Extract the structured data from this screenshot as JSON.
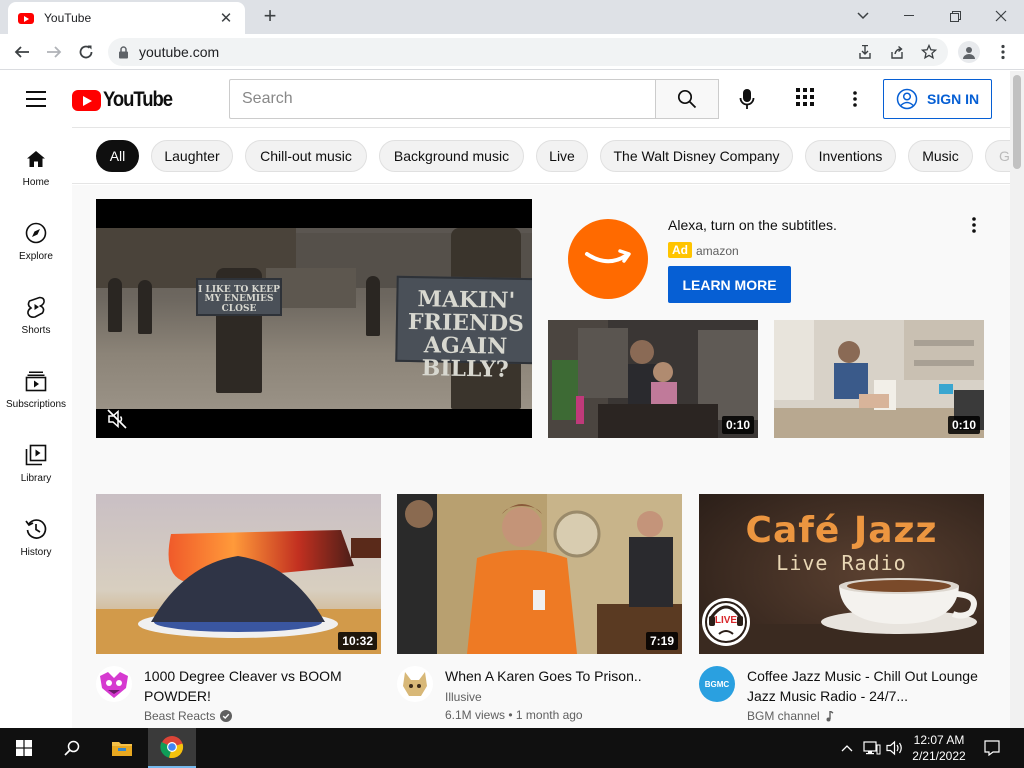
{
  "browser": {
    "tab_title": "YouTube",
    "url": "youtube.com"
  },
  "masthead": {
    "logo_text": "YouTube",
    "search_placeholder": "Search",
    "sign_in_label": "SIGN IN"
  },
  "guide": {
    "items": [
      {
        "label": "Home",
        "icon": "home-icon"
      },
      {
        "label": "Explore",
        "icon": "compass-icon"
      },
      {
        "label": "Shorts",
        "icon": "shorts-icon"
      },
      {
        "label": "Subscriptions",
        "icon": "subscriptions-icon"
      },
      {
        "label": "Library",
        "icon": "library-icon"
      },
      {
        "label": "History",
        "icon": "history-icon"
      }
    ]
  },
  "chips": [
    "All",
    "Laughter",
    "Chill-out music",
    "Background music",
    "Live",
    "The Walt Disney Company",
    "Inventions",
    "Music",
    "G"
  ],
  "ad": {
    "scene_sign_left": "I LIKE TO KEEP MY ENEMIES CLOSE",
    "scene_sign_right": "MAKIN' FRIENDS AGAIN BILLY?",
    "title": "Alexa, turn on the subtitles.",
    "badge": "Ad",
    "source": "amazon",
    "cta": "LEARN MORE",
    "thumb1_duration": "0:10",
    "thumb2_duration": "0:10"
  },
  "videos": [
    {
      "title": "1000 Degree Cleaver vs BOOM POWDER!",
      "channel": "Beast Reacts",
      "verified": true,
      "stats": "",
      "duration": "10:32"
    },
    {
      "title": "When A Karen Goes To Prison..",
      "channel": "Illusive",
      "verified": false,
      "stats": "6.1M views • 1 month ago",
      "duration": "7:19"
    },
    {
      "title": "Coffee Jazz Music - Chill Out Lounge Jazz Music Radio - 24/7...",
      "channel": "BGM channel",
      "verified": false,
      "stats": "",
      "duration": "",
      "thumb_line1": "Café Jazz",
      "thumb_line2": "Live Radio",
      "live_badge": "LIVE",
      "avatar_text": "BGMC"
    }
  ],
  "taskbar": {
    "time": "12:07 AM",
    "date": "2/21/2022"
  },
  "colors": {
    "youtube_red": "#ff0000",
    "link_blue": "#065fd4",
    "ad_yellow": "#ffc400",
    "amazon_orange": "#ff6a00"
  }
}
